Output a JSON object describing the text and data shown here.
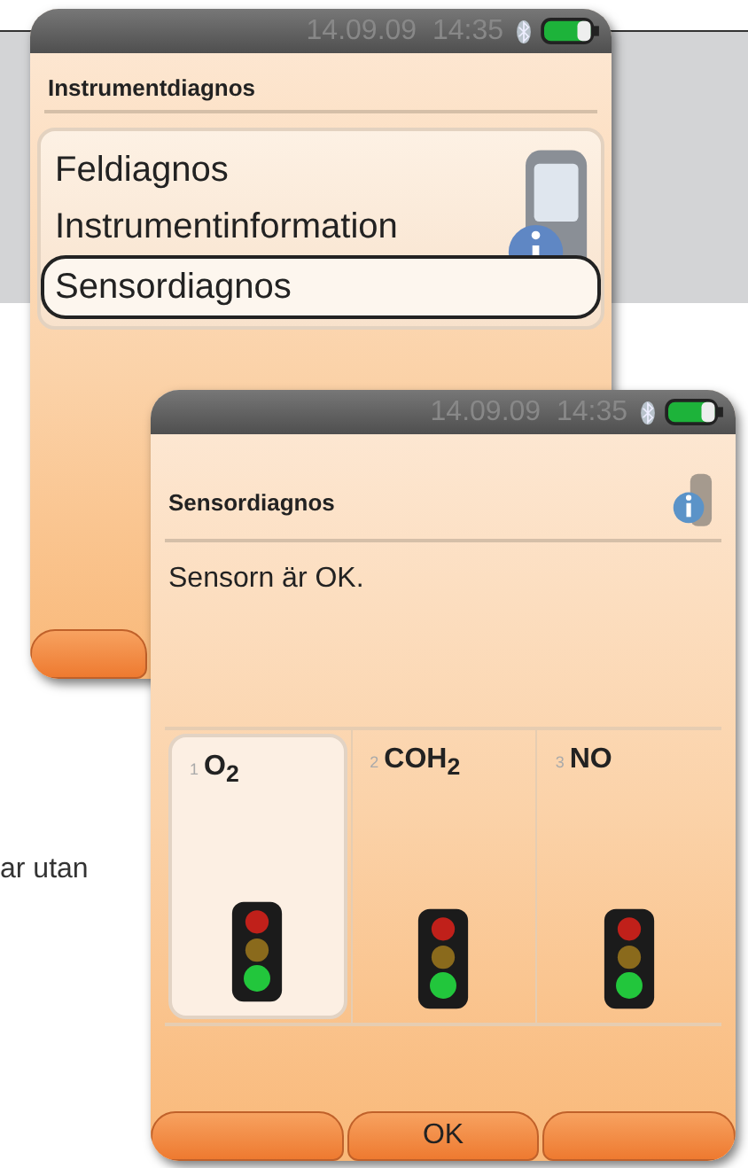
{
  "page_text": "ar utan",
  "menu_screen": {
    "status": {
      "date": "14.09.09",
      "time": "14:35"
    },
    "title": "Instrumentdiagnos",
    "menu": [
      {
        "label": "Feldiagnos",
        "selected": false
      },
      {
        "label": "Instrumentinformation",
        "selected": false
      },
      {
        "label": "Sensordiagnos",
        "selected": true
      }
    ],
    "softkeys": [
      {
        "kind": "blank"
      }
    ]
  },
  "sensor_screen": {
    "status": {
      "date": "14.09.09",
      "time": "14:35"
    },
    "title": "Sensordiagnos",
    "message": "Sensorn är OK.",
    "sensors": [
      {
        "number": "1",
        "name": "O$_{2}$",
        "selected": true
      },
      {
        "number": "2",
        "name": "COH$_{2}$",
        "selected": false
      },
      {
        "number": "3",
        "name": "NO",
        "selected": false
      }
    ],
    "softkeys": [
      {
        "kind": "blank"
      },
      {
        "kind": "label",
        "label": "OK"
      },
      {
        "kind": "blank"
      }
    ]
  }
}
